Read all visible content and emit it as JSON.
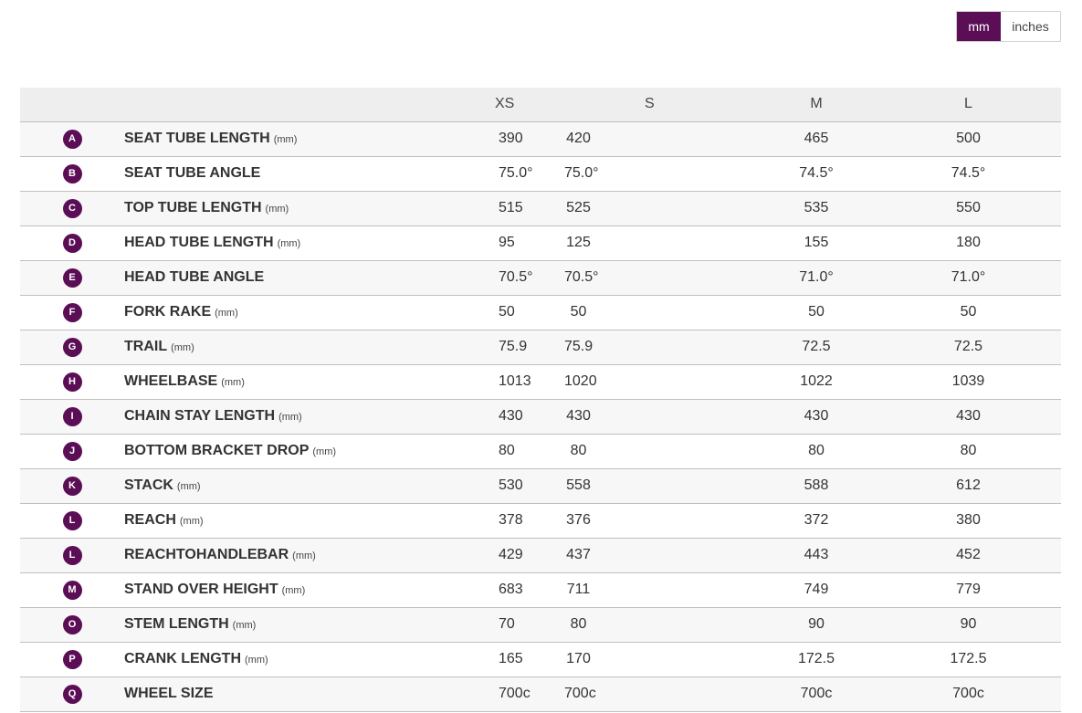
{
  "unit_toggle": {
    "options": [
      "mm",
      "inches"
    ],
    "selected": "mm",
    "accent_color": "#5b0e56"
  },
  "table": {
    "headers": [
      "",
      "",
      "XS",
      "S",
      "M",
      "L"
    ],
    "rows": [
      {
        "letter": "A",
        "label": "SEAT TUBE LENGTH",
        "unit": "(mm)",
        "values": [
          "390",
          "420",
          "465",
          "500"
        ]
      },
      {
        "letter": "B",
        "label": "SEAT TUBE ANGLE",
        "unit": "",
        "values": [
          "75.0°",
          "75.0°",
          "74.5°",
          "74.5°"
        ]
      },
      {
        "letter": "C",
        "label": "TOP TUBE LENGTH",
        "unit": "(mm)",
        "values": [
          "515",
          "525",
          "535",
          "550"
        ]
      },
      {
        "letter": "D",
        "label": "HEAD TUBE LENGTH",
        "unit": "(mm)",
        "values": [
          "95",
          "125",
          "155",
          "180"
        ]
      },
      {
        "letter": "E",
        "label": "HEAD TUBE ANGLE",
        "unit": "",
        "values": [
          "70.5°",
          "70.5°",
          "71.0°",
          "71.0°"
        ]
      },
      {
        "letter": "F",
        "label": "FORK RAKE",
        "unit": "(mm)",
        "values": [
          "50",
          "50",
          "50",
          "50"
        ]
      },
      {
        "letter": "G",
        "label": "TRAIL",
        "unit": "(mm)",
        "values": [
          "75.9",
          "75.9",
          "72.5",
          "72.5"
        ]
      },
      {
        "letter": "H",
        "label": "WHEELBASE",
        "unit": "(mm)",
        "values": [
          "1013",
          "1020",
          "1022",
          "1039"
        ]
      },
      {
        "letter": "I",
        "label": "CHAIN STAY LENGTH",
        "unit": "(mm)",
        "values": [
          "430",
          "430",
          "430",
          "430"
        ]
      },
      {
        "letter": "J",
        "label": "BOTTOM BRACKET DROP",
        "unit": "(mm)",
        "values": [
          "80",
          "80",
          "80",
          "80"
        ]
      },
      {
        "letter": "K",
        "label": "STACK",
        "unit": "(mm)",
        "values": [
          "530",
          "558",
          "588",
          "612"
        ]
      },
      {
        "letter": "L",
        "label": "REACH",
        "unit": "(mm)",
        "values": [
          "378",
          "376",
          "372",
          "380"
        ]
      },
      {
        "letter": "L",
        "label": "REACHTOHANDLEBAR",
        "unit": "(mm)",
        "values": [
          "429",
          "437",
          "443",
          "452"
        ]
      },
      {
        "letter": "M",
        "label": "STAND OVER HEIGHT",
        "unit": "(mm)",
        "values": [
          "683",
          "711",
          "749",
          "779"
        ]
      },
      {
        "letter": "O",
        "label": "STEM LENGTH",
        "unit": "(mm)",
        "values": [
          "70",
          "80",
          "90",
          "90"
        ]
      },
      {
        "letter": "P",
        "label": "CRANK LENGTH",
        "unit": "(mm)",
        "values": [
          "165",
          "170",
          "172.5",
          "172.5"
        ]
      },
      {
        "letter": "Q",
        "label": "WHEEL SIZE",
        "unit": "",
        "values": [
          "700c",
          "700c",
          "700c",
          "700c"
        ]
      }
    ]
  }
}
